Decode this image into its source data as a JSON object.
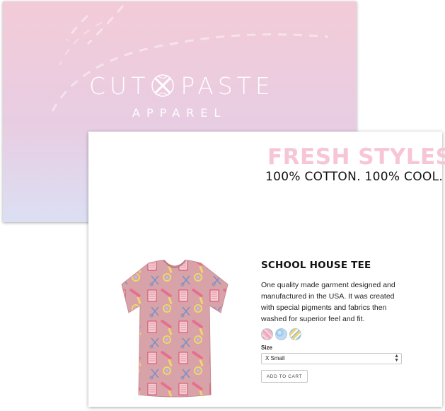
{
  "brand_card": {
    "logo_left": "CUT",
    "logo_right": "PASTE",
    "tagline": "APPAREL",
    "logo_icon": "scissors-x-icon",
    "gradient_colors": [
      "#f3cbd8",
      "#e8cde2",
      "#dcdff3"
    ]
  },
  "product_card": {
    "headline": "FRESH STYLES",
    "subhead": "100% COTTON. 100% COOL.",
    "product": {
      "title": "SCHOOL HOUSE TEE",
      "description": "One quality made garment designed and manufactured in the USA. It was created with special pigments and fabrics then washed for superior feel and fit.",
      "image_icon": "school-supplies-tshirt-icon",
      "swatches": [
        {
          "name": "pink-swatch",
          "color": "#f2b7c7"
        },
        {
          "name": "blue-swatch",
          "color": "#9fcbed"
        },
        {
          "name": "yellow-swatch",
          "color": "#f3d56a"
        }
      ],
      "size_label": "Size",
      "size_selected": "X Small",
      "add_to_cart": "ADD TO CART"
    }
  },
  "colors": {
    "headline": "#f7c6d6",
    "text": "#111111"
  }
}
